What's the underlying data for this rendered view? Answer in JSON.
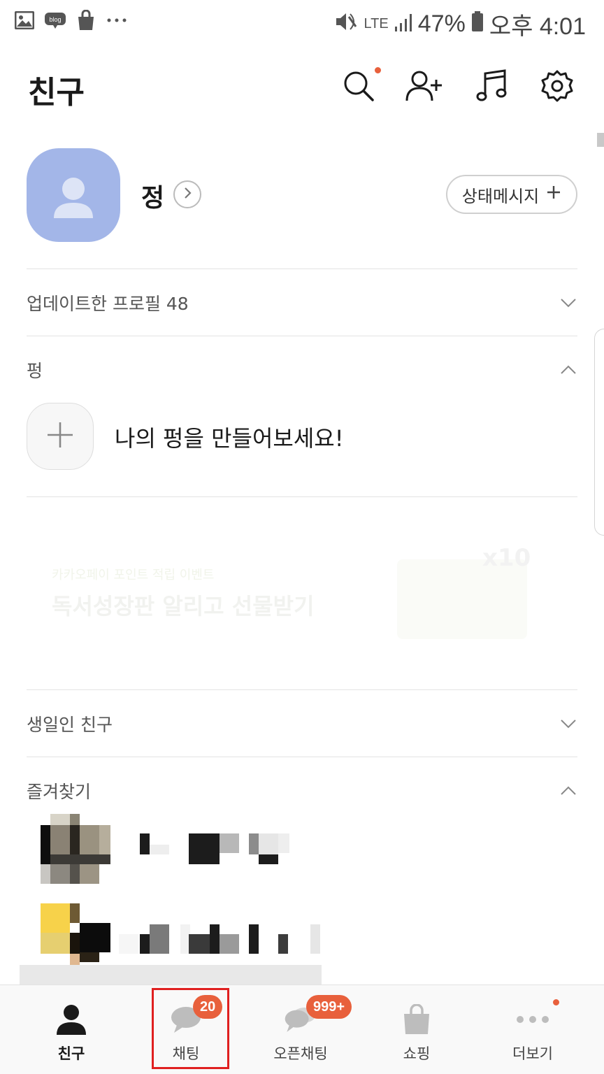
{
  "status_bar": {
    "battery": "47%",
    "time": "오후 4:01",
    "network": "LTE",
    "left_icons": [
      "gallery-icon",
      "blog-icon",
      "shopping-bag-icon",
      "more-dots-icon"
    ]
  },
  "header": {
    "title": "친구",
    "actions": [
      "search-icon",
      "add-friend-icon",
      "music-icon",
      "settings-icon"
    ]
  },
  "profile": {
    "name": "정",
    "status_message_button": "상태메시지"
  },
  "sections": {
    "updated_profiles": "업데이트한 프로필 48",
    "pyeong": "펑",
    "pyeong_prompt": "나의 펑을 만들어보세요!",
    "birthday": "생일인 친구",
    "favorites": "즐겨찾기"
  },
  "banner": {
    "subtitle": "카카오페이 포인트 적립 이벤트",
    "title": "독서성장판 알리고 선물받기",
    "badge": "x10"
  },
  "bottom_nav": {
    "items": [
      {
        "label": "친구",
        "icon": "person-icon",
        "active": true
      },
      {
        "label": "채팅",
        "icon": "chat-icon",
        "badge": "20"
      },
      {
        "label": "오픈채팅",
        "icon": "open-chat-icon",
        "badge": "999+"
      },
      {
        "label": "쇼핑",
        "icon": "shopping-bag-icon"
      },
      {
        "label": "더보기",
        "icon": "more-icon"
      }
    ]
  },
  "colors": {
    "accent": "#e8603c",
    "avatar": "#a3b6e8",
    "highlight": "#e02020"
  }
}
